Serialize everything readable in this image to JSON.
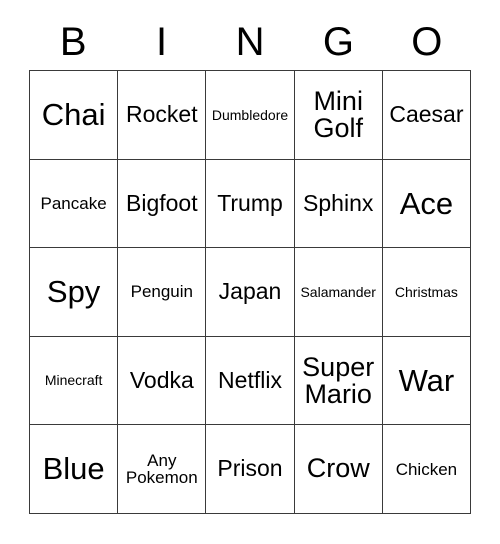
{
  "card": {
    "title_letters": [
      "B",
      "I",
      "N",
      "G",
      "O"
    ],
    "columns": 5,
    "rows": 5,
    "border_color": "#3a3a3a",
    "background_color": "#ffffff",
    "text_color": "#000000",
    "cells": [
      [
        {
          "label": "Chai",
          "size": "xl",
          "lines": 1
        },
        {
          "label": "Rocket",
          "size": "md",
          "lines": 1
        },
        {
          "label": "Dumbledore",
          "size": "xs",
          "lines": 1
        },
        {
          "label": "Mini\nGolf",
          "size": "lg",
          "lines": 2
        },
        {
          "label": "Caesar",
          "size": "md",
          "lines": 1
        }
      ],
      [
        {
          "label": "Pancake",
          "size": "sm",
          "lines": 1
        },
        {
          "label": "Bigfoot",
          "size": "md",
          "lines": 1
        },
        {
          "label": "Trump",
          "size": "md",
          "lines": 1
        },
        {
          "label": "Sphinx",
          "size": "md",
          "lines": 1
        },
        {
          "label": "Ace",
          "size": "xl",
          "lines": 1
        }
      ],
      [
        {
          "label": "Spy",
          "size": "xl",
          "lines": 1
        },
        {
          "label": "Penguin",
          "size": "sm",
          "lines": 1
        },
        {
          "label": "Japan",
          "size": "md",
          "lines": 1
        },
        {
          "label": "Salamander",
          "size": "xs",
          "lines": 1
        },
        {
          "label": "Christmas",
          "size": "xs",
          "lines": 1
        }
      ],
      [
        {
          "label": "Minecraft",
          "size": "xs",
          "lines": 1
        },
        {
          "label": "Vodka",
          "size": "md",
          "lines": 1
        },
        {
          "label": "Netflix",
          "size": "md",
          "lines": 1
        },
        {
          "label": "Super\nMario",
          "size": "lg",
          "lines": 2
        },
        {
          "label": "War",
          "size": "xl",
          "lines": 1
        }
      ],
      [
        {
          "label": "Blue",
          "size": "xl",
          "lines": 1
        },
        {
          "label": "Any\nPokemon",
          "size": "sm",
          "lines": 2
        },
        {
          "label": "Prison",
          "size": "md",
          "lines": 1
        },
        {
          "label": "Crow",
          "size": "lg",
          "lines": 1
        },
        {
          "label": "Chicken",
          "size": "sm",
          "lines": 1
        }
      ]
    ]
  }
}
